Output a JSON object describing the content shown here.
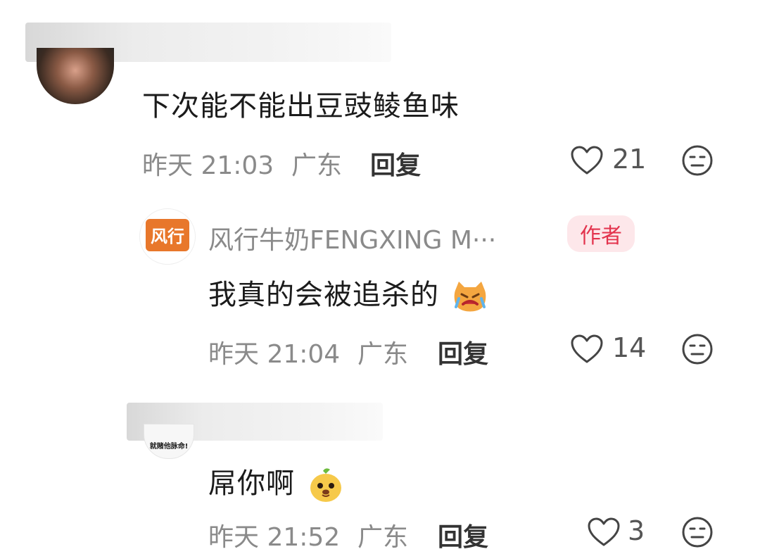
{
  "comments": [
    {
      "text": "下次能不能出豆豉鲮鱼味",
      "time": "昨天 21:03",
      "location": "广东",
      "reply_label": "回复",
      "likes": "21"
    },
    {
      "author": "风行牛奶FENGXING M···",
      "author_badge": "作者",
      "avatar_logo_text": "风行",
      "text": "我真的会被追杀的",
      "time": "昨天 21:04",
      "location": "广东",
      "reply_label": "回复",
      "likes": "14",
      "emoji": "crying-cat-emoji"
    },
    {
      "avatar_caption": "就赌他脉命!",
      "text": "屌你啊",
      "time": "昨天 21:52",
      "location": "广东",
      "reply_label": "回复",
      "likes": "3",
      "emoji": "mango-dog-emoji"
    }
  ],
  "colors": {
    "badge_bg": "#fde7ea",
    "badge_text": "#e3334d",
    "brand_orange": "#e8772b",
    "meta_gray": "#8a8a8a"
  }
}
